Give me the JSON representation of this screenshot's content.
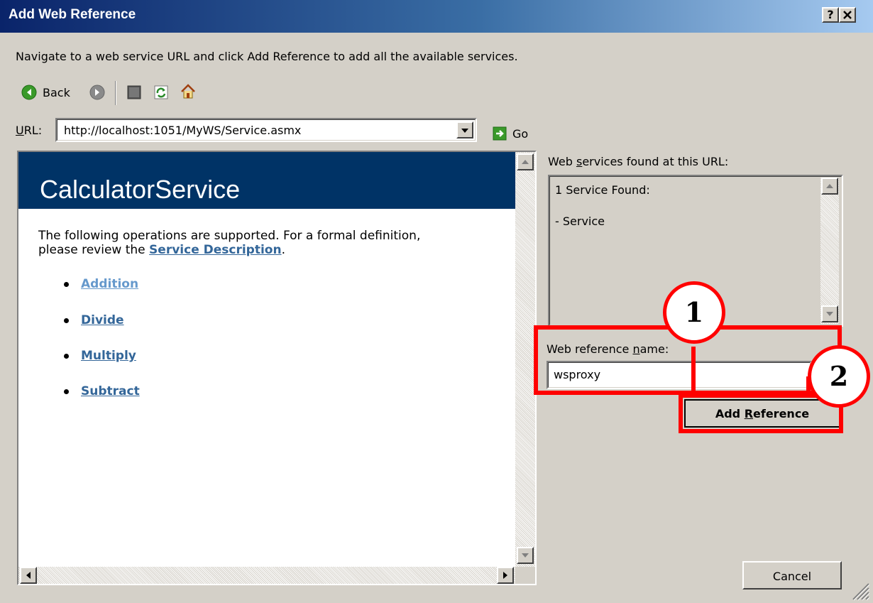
{
  "window": {
    "title": "Add Web Reference",
    "help_button": "?",
    "close_button": "✕"
  },
  "instruction": "Navigate to a web service URL and click Add Reference to add all the available services.",
  "toolbar": {
    "back_label": "Back",
    "icons": [
      "back-icon",
      "forward-icon",
      "stop-icon",
      "refresh-icon",
      "home-icon"
    ]
  },
  "url_bar": {
    "label": "URL:",
    "value": "http://localhost:1051/MyWS/Service.asmx",
    "go_label": "Go"
  },
  "browser": {
    "page_title": "CalculatorService",
    "intro_line1": "The following operations are supported. For a formal definition,",
    "intro_line2_prefix": "please review the ",
    "service_description_link": "Service Description",
    "intro_line2_suffix": ".",
    "operations": [
      "Addition",
      "Divide",
      "Multiply",
      "Subtract"
    ],
    "header_color": "#003366",
    "visited_link_color": "#6699cc",
    "link_color": "#336699"
  },
  "services_panel": {
    "label": "Web services found at this URL:",
    "found_text": "1 Service Found:",
    "service_item": "- Service"
  },
  "reference": {
    "label": "Web reference name:",
    "value": "wsproxy",
    "add_button": "Add Reference",
    "cancel_button": "Cancel"
  },
  "annotations": {
    "callout_1": "1",
    "callout_2": "2",
    "color": "#ff0000"
  }
}
